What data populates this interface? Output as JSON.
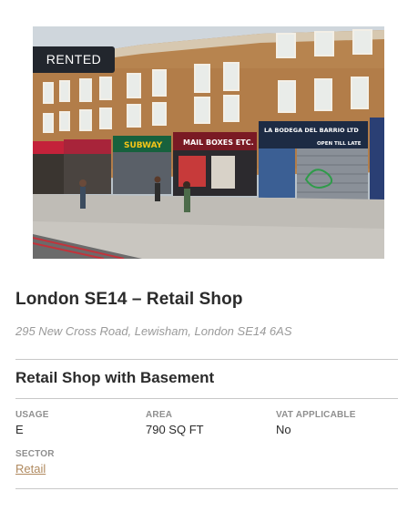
{
  "listing": {
    "status_badge": "RENTED",
    "title": "London SE14 – Retail Shop",
    "address": "295 New Cross Road, Lewisham, London SE14 6AS",
    "subtitle": "Retail Shop with Basement",
    "photo_alt": "Street view of retail shops on New Cross Road",
    "storefront_signs": [
      "SUBWAY",
      "MAIL BOXES ETC.",
      "LA BODEGA DEL BARRIO LTD",
      "OPEN TILL LATE"
    ]
  },
  "specs": {
    "usage": {
      "label": "USAGE",
      "value": "E"
    },
    "area": {
      "label": "AREA",
      "value": "790 SQ FT"
    },
    "vat": {
      "label": "VAT APPLICABLE",
      "value": "No"
    },
    "sector": {
      "label": "SECTOR",
      "value": "Retail"
    }
  },
  "colors": {
    "badge_bg": "#22262d",
    "link": "#b08a5f",
    "divider": "#c8c8c8",
    "muted_text": "#9a9a9a",
    "heading_text": "#2b2b2b"
  }
}
